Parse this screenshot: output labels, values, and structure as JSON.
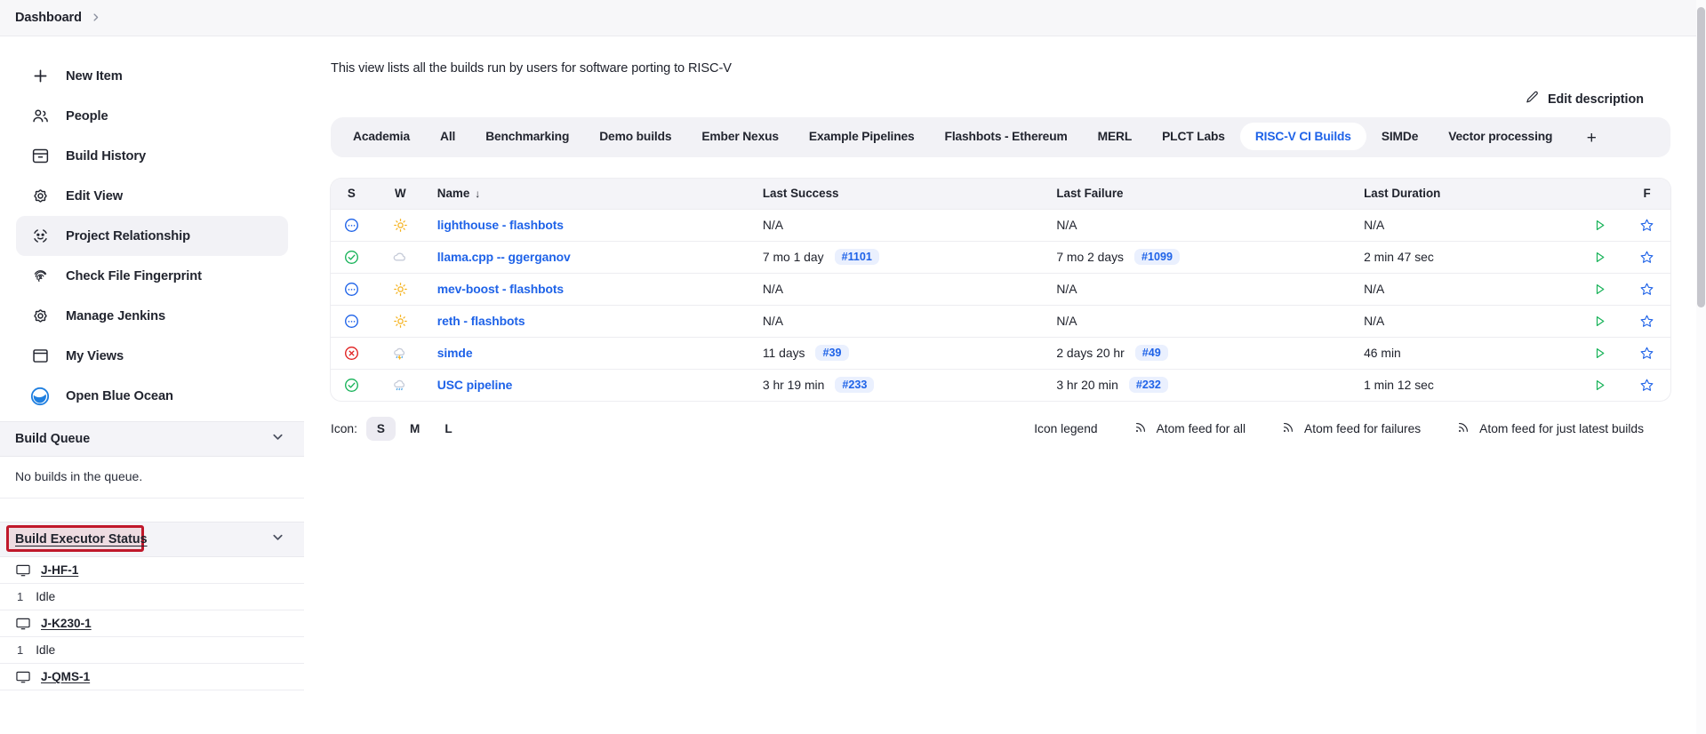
{
  "breadcrumb": {
    "root": "Dashboard",
    "separator": "›"
  },
  "sidebar": {
    "items": [
      {
        "label": "New Item",
        "icon": "plus-icon",
        "active": false
      },
      {
        "label": "People",
        "icon": "people-icon",
        "active": false
      },
      {
        "label": "Build History",
        "icon": "build-history-icon",
        "active": false
      },
      {
        "label": "Edit View",
        "icon": "gear-icon",
        "active": false
      },
      {
        "label": "Project Relationship",
        "icon": "project-relationship-icon",
        "active": true
      },
      {
        "label": "Check File Fingerprint",
        "icon": "fingerprint-icon",
        "active": false
      },
      {
        "label": "Manage Jenkins",
        "icon": "gear-icon",
        "active": false
      },
      {
        "label": "My Views",
        "icon": "my-views-icon",
        "active": false
      },
      {
        "label": "Open Blue Ocean",
        "icon": "blue-ocean-icon",
        "active": false
      }
    ],
    "build_queue": {
      "title": "Build Queue",
      "empty_text": "No builds in the queue.",
      "collapse_icon": "chevron-down-icon"
    },
    "build_executor_status": {
      "title": "Build Executor Status",
      "collapse_icon": "chevron-down-icon",
      "highlighted": true,
      "highlight_color": "#c0182b",
      "executors": [
        {
          "name": "J-HF-1",
          "icon": "computer-icon",
          "slot": "1",
          "status": "Idle"
        },
        {
          "name": "J-K230-1",
          "icon": "computer-icon",
          "slot": "1",
          "status": "Idle"
        },
        {
          "name": "J-QMS-1",
          "icon": "computer-icon",
          "slot": "",
          "status": ""
        }
      ]
    }
  },
  "main": {
    "description": "This view lists all the builds run by users for software porting to RISC-V",
    "edit_description": {
      "label": "Edit description",
      "icon": "pencil-icon"
    },
    "tabs": [
      {
        "label": "Academia",
        "selected": false
      },
      {
        "label": "All",
        "selected": false
      },
      {
        "label": "Benchmarking",
        "selected": false
      },
      {
        "label": "Demo builds",
        "selected": false
      },
      {
        "label": "Ember Nexus",
        "selected": false
      },
      {
        "label": "Example Pipelines",
        "selected": false
      },
      {
        "label": "Flashbots - Ethereum",
        "selected": false
      },
      {
        "label": "MERL",
        "selected": false
      },
      {
        "label": "PLCT Labs",
        "selected": false
      },
      {
        "label": "RISC-V CI Builds",
        "selected": true
      },
      {
        "label": "SIMDe",
        "selected": false
      },
      {
        "label": "Vector processing",
        "selected": false
      }
    ],
    "tab_add_label": "+",
    "table": {
      "columns": [
        {
          "key": "s",
          "label": "S"
        },
        {
          "key": "w",
          "label": "W"
        },
        {
          "key": "name",
          "label": "Name",
          "sorted": true,
          "sort_arrow": "↓"
        },
        {
          "key": "last_success",
          "label": "Last Success"
        },
        {
          "key": "last_failure",
          "label": "Last Failure"
        },
        {
          "key": "last_duration",
          "label": "Last Duration"
        },
        {
          "key": "run",
          "label": ""
        },
        {
          "key": "f",
          "label": "F"
        }
      ],
      "rows": [
        {
          "status": "pending",
          "status_icon": "status-pending-icon",
          "weather": "sunny",
          "weather_icon": "weather-sunny-icon",
          "name": "lighthouse - flashbots",
          "last_success": "N/A",
          "last_success_build": "",
          "last_failure": "N/A",
          "last_failure_build": "",
          "last_duration": "N/A",
          "run_icon": "run-build-icon",
          "favorite_icon": "star-icon"
        },
        {
          "status": "success",
          "status_icon": "status-success-icon",
          "weather": "cloudy",
          "weather_icon": "weather-cloudy-icon",
          "name": "llama.cpp -- ggerganov",
          "last_success": "7 mo 1 day",
          "last_success_build": "#1101",
          "last_failure": "7 mo 2 days",
          "last_failure_build": "#1099",
          "last_duration": "2 min 47 sec",
          "run_icon": "run-build-icon",
          "favorite_icon": "star-icon"
        },
        {
          "status": "pending",
          "status_icon": "status-pending-icon",
          "weather": "sunny",
          "weather_icon": "weather-sunny-icon",
          "name": "mev-boost - flashbots",
          "last_success": "N/A",
          "last_success_build": "",
          "last_failure": "N/A",
          "last_failure_build": "",
          "last_duration": "N/A",
          "run_icon": "run-build-icon",
          "favorite_icon": "star-icon"
        },
        {
          "status": "pending",
          "status_icon": "status-pending-icon",
          "weather": "sunny",
          "weather_icon": "weather-sunny-icon",
          "name": "reth - flashbots",
          "last_success": "N/A",
          "last_success_build": "",
          "last_failure": "N/A",
          "last_failure_build": "",
          "last_duration": "N/A",
          "run_icon": "run-build-icon",
          "favorite_icon": "star-icon"
        },
        {
          "status": "failed",
          "status_icon": "status-failed-icon",
          "weather": "storm",
          "weather_icon": "weather-storm-icon",
          "name": "simde",
          "last_success": "11 days",
          "last_success_build": "#39",
          "last_failure": "2 days 20 hr",
          "last_failure_build": "#49",
          "last_duration": "46 min",
          "run_icon": "run-build-icon",
          "favorite_icon": "star-icon"
        },
        {
          "status": "success",
          "status_icon": "status-success-icon",
          "weather": "rain",
          "weather_icon": "weather-rain-icon",
          "name": "USC pipeline",
          "last_success": "3 hr 19 min",
          "last_success_build": "#233",
          "last_failure": "3 hr 20 min",
          "last_failure_build": "#232",
          "last_duration": "1 min 12 sec",
          "run_icon": "run-build-icon",
          "favorite_icon": "star-icon"
        }
      ]
    },
    "footer": {
      "icon_label": "Icon:",
      "sizes": [
        {
          "label": "S",
          "selected": true
        },
        {
          "label": "M",
          "selected": false
        },
        {
          "label": "L",
          "selected": false
        }
      ],
      "icon_legend": "Icon legend",
      "feeds": [
        {
          "label": "Atom feed for all",
          "icon": "rss-icon"
        },
        {
          "label": "Atom feed for failures",
          "icon": "rss-icon"
        },
        {
          "label": "Atom feed for just latest builds",
          "icon": "rss-icon"
        }
      ]
    }
  },
  "colors": {
    "accent_blue": "#1f63e8",
    "success_green": "#19b35a",
    "failure_red": "#e02020",
    "pending_blue": "#1f63e8",
    "weather_sunny": "#f5b320",
    "highlight_red": "#c0182b"
  }
}
